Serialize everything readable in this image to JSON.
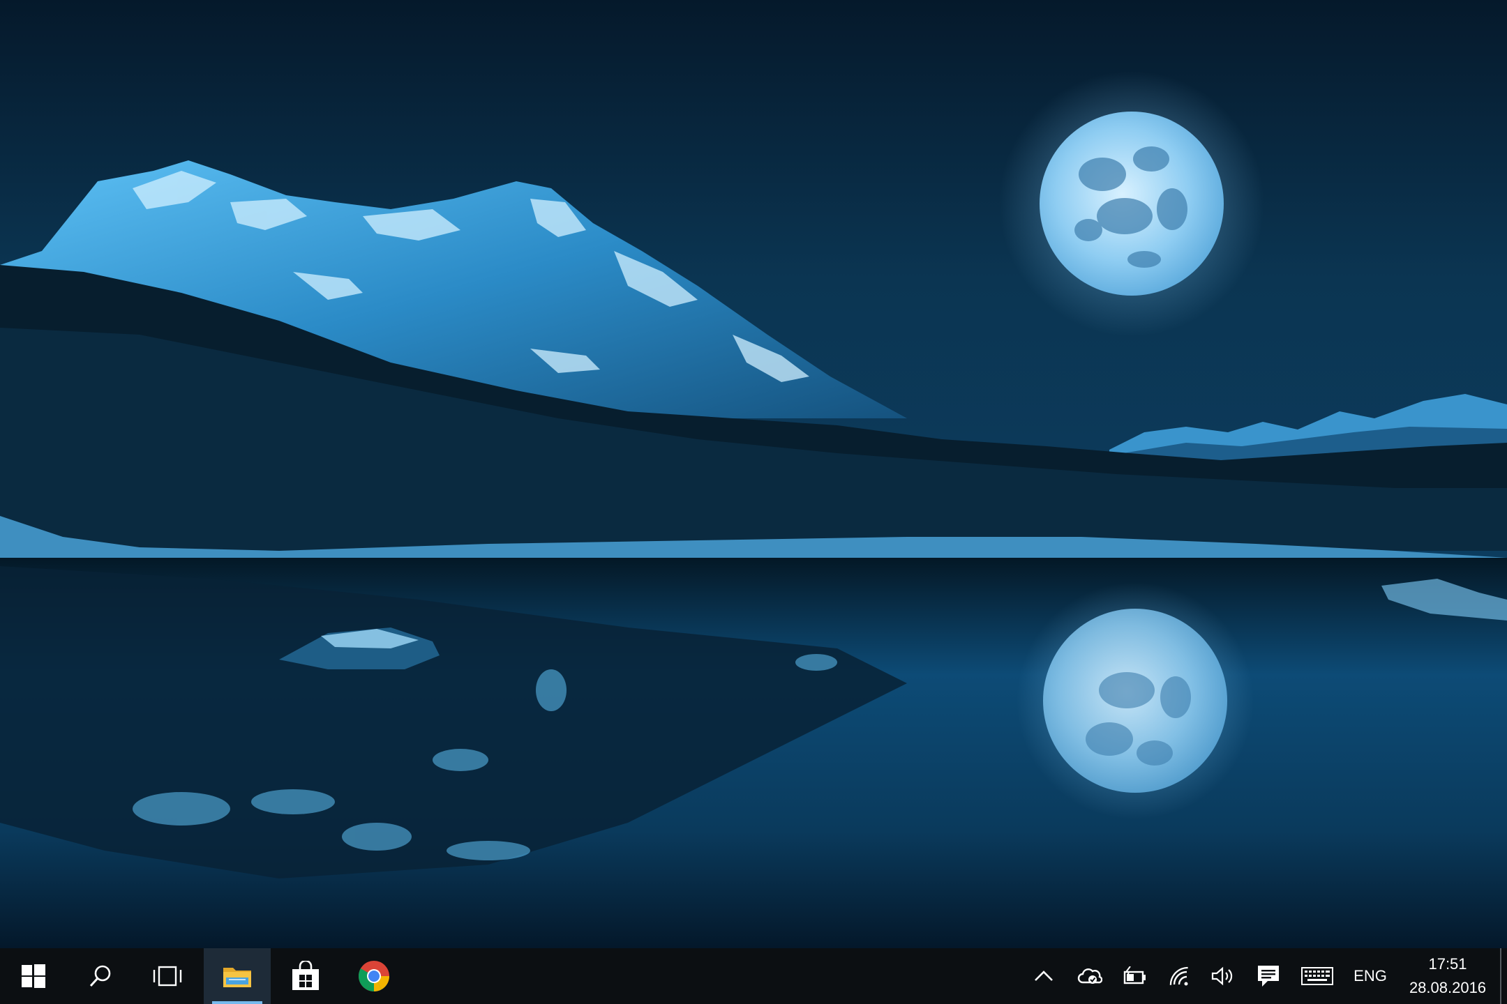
{
  "taskbar": {
    "start_icon": "windows-logo-icon",
    "search_icon": "search-icon",
    "task_view_icon": "task-view-icon",
    "pinned_apps": [
      {
        "icon": "file-explorer-icon",
        "active": true
      },
      {
        "icon": "store-icon",
        "active": false
      },
      {
        "icon": "chrome-icon",
        "active": false
      }
    ],
    "tray": {
      "show_hidden_icon": "chevron-up-icon",
      "onedrive_icon": "onedrive-icon",
      "battery_icon": "battery-charging-icon",
      "wifi_icon": "wifi-icon",
      "volume_icon": "volume-icon",
      "action_center_icon": "action-center-icon",
      "keyboard_icon": "touch-keyboard-icon",
      "language": "ENG"
    },
    "clock": {
      "time": "17:51",
      "date": "28.08.2016"
    },
    "accent_color": "#76b9ed",
    "background_color": "#0c0f12"
  }
}
